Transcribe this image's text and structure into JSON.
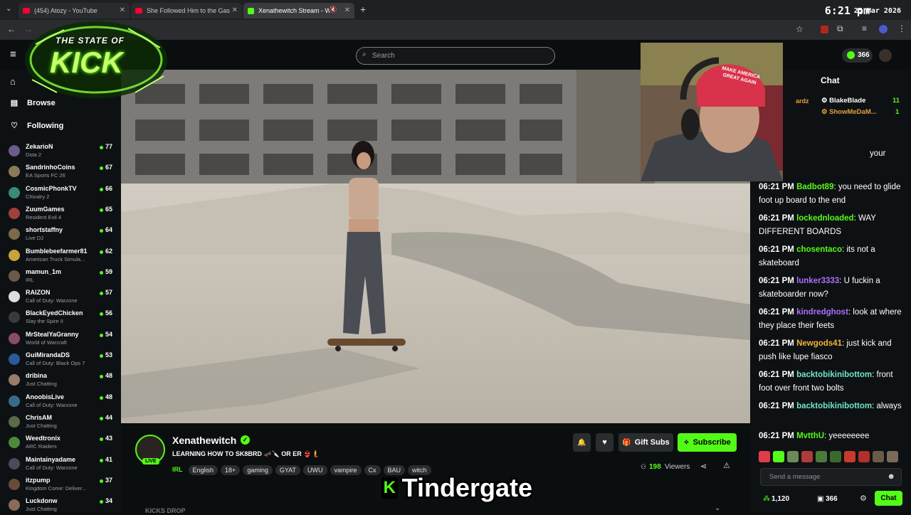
{
  "browser": {
    "tabs": [
      {
        "title": "(454) Atozy - YouTube"
      },
      {
        "title": "She Followed Him to the Gas Station"
      },
      {
        "title": "Xenathewitch Stream - Watch Live"
      }
    ],
    "new_tab": "+",
    "clock": "6:21 pm",
    "date": "25 Mar 2026"
  },
  "overlay": {
    "logo": {
      "line1": "THE STATE OF",
      "line2": "KICK"
    },
    "cam_hat": "MAKE AMERICA GREAT AGAIN",
    "caption": {
      "text": "Tindergate",
      "icon": "K"
    }
  },
  "search": {
    "placeholder": "Search"
  },
  "header": {
    "viewer_count": "366"
  },
  "sidebar": {
    "nav": [
      {
        "label": "Browse"
      },
      {
        "label": "Following"
      }
    ],
    "channels": [
      {
        "name": "ZekarioN",
        "game": "Dota 2",
        "viewers": "77",
        "color": "#6b5a8a"
      },
      {
        "name": "SandrinhoCoins",
        "game": "EA Sports FC 26",
        "viewers": "67",
        "color": "#8a7a5a"
      },
      {
        "name": "CosmicPhonkTV",
        "game": "Chivalry 2",
        "viewers": "66",
        "color": "#3a8a7a"
      },
      {
        "name": "ZuumGames",
        "game": "Resident Evil 4",
        "viewers": "65",
        "color": "#a0403a"
      },
      {
        "name": "shortstaffny",
        "game": "Live DJ",
        "viewers": "64",
        "color": "#7a6a4a"
      },
      {
        "name": "Bumblebeefarmer81",
        "game": "American Truck Simula...",
        "viewers": "62",
        "color": "#c8a23a"
      },
      {
        "name": "mamun_1m",
        "game": "IRL",
        "viewers": "59",
        "color": "#6a5a4a"
      },
      {
        "name": "RAIZON",
        "game": "Call of Duty: Warzone",
        "viewers": "57",
        "color": "#dddddd"
      },
      {
        "name": "BlackEyedChicken",
        "game": "Slay the Spire II",
        "viewers": "56",
        "color": "#3a3a3a"
      },
      {
        "name": "MrStealYaGranny",
        "game": "World of Warcraft",
        "viewers": "54",
        "color": "#8a4a6a"
      },
      {
        "name": "GuiMirandaDS",
        "game": "Call of Duty: Black Ops 7",
        "viewers": "53",
        "color": "#2a5a9a"
      },
      {
        "name": "dribina",
        "game": "Just Chatting",
        "viewers": "48",
        "color": "#9a7a6a"
      },
      {
        "name": "AnoobisLive",
        "game": "Call of Duty: Warzone",
        "viewers": "48",
        "color": "#3a6a8a"
      },
      {
        "name": "ChrisAM",
        "game": "Just Chatting",
        "viewers": "44",
        "color": "#5a6a4a"
      },
      {
        "name": "Weedtronix",
        "game": "ARC Raiders",
        "viewers": "43",
        "color": "#4a8a3a"
      },
      {
        "name": "Maintainyadame",
        "game": "Call of Duty: Warzone",
        "viewers": "41",
        "color": "#4a4a5a"
      },
      {
        "name": "itzpump",
        "game": "Kingdom Come: Deliver...",
        "viewers": "37",
        "color": "#6a4a3a"
      },
      {
        "name": "Luckdonw",
        "game": "Just Chatting",
        "viewers": "34",
        "color": "#8a6a5a"
      }
    ]
  },
  "stream": {
    "channel": "Xenathewitch",
    "live": "LIVE",
    "title": "LEARNING HOW TO SK8BRD 🛹🔪 OR ER 👙🧜",
    "category": "IRL",
    "tags": [
      "English",
      "18+",
      "gaming",
      "GYAT",
      "UWU",
      "vampire",
      "Cx",
      "BAU",
      "witch"
    ],
    "viewers_count": "198",
    "viewers_label": "Viewers",
    "gift_label": "Gift Subs",
    "subscribe_label": "Subscribe",
    "below": "KICKS drop"
  },
  "chat": {
    "title": "Chat",
    "pinned": [
      {
        "name": "BlakeBlade",
        "count": "11"
      },
      {
        "name": "ShowMeDaM...",
        "count": "1"
      }
    ],
    "partial": "ardz",
    "partial2": "your",
    "messages": [
      {
        "time": "06:21 PM",
        "user": "Badbot89",
        "color": "#53fc18",
        "text": "you need to glide foot up board to the end"
      },
      {
        "time": "06:21 PM",
        "user": "lockednloaded",
        "color": "#53fc18",
        "text": "WAY DIFFERENT BOARDS"
      },
      {
        "time": "06:21 PM",
        "user": "chosentaco",
        "color": "#53fc18",
        "text": "its not a skateboard"
      },
      {
        "time": "06:21 PM",
        "user": "lunker3333",
        "color": "#a970ff",
        "text": "U fuckin a skateboarder now?"
      },
      {
        "time": "06:21 PM",
        "user": "kindredghost",
        "color": "#a970ff",
        "text": "look at where they place their feets"
      },
      {
        "time": "06:21 PM",
        "user": "Newgods41",
        "color": "#f0b43c",
        "text": "just kick and push like lupe fiasco"
      },
      {
        "time": "06:21 PM",
        "user": "backtobikinibottom",
        "color": "#70e6c8",
        "text": "front foot over front two bolts"
      },
      {
        "time": "06:21 PM",
        "user": "backtobikinibottom",
        "color": "#70e6c8",
        "text": "always"
      },
      {
        "time": "06:21 PM",
        "user": "MvtthU",
        "color": "#53fc18",
        "text": "yeeeeeeee"
      }
    ],
    "input_placeholder": "Send a message",
    "points": "1,120",
    "viewers": "366",
    "send_label": "Chat"
  },
  "colors": {
    "accent": "#53fc18",
    "background": "#0b0e0f",
    "panel": "#0e1113"
  }
}
